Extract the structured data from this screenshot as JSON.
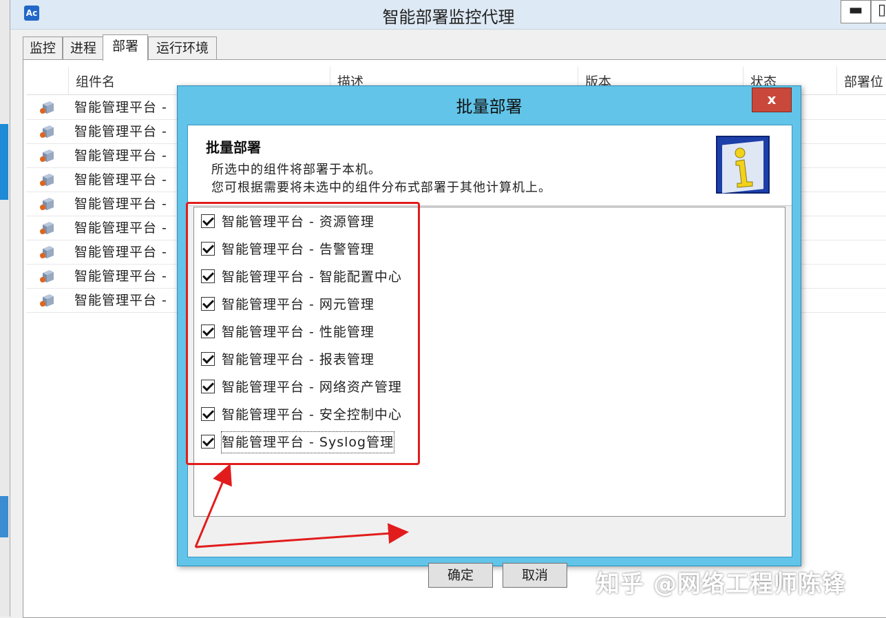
{
  "window": {
    "title": "智能部署监控代理",
    "minimize_label": "▬",
    "maximize_label": "▯"
  },
  "tabs": [
    {
      "label": "监控"
    },
    {
      "label": "进程"
    },
    {
      "label": "部署"
    },
    {
      "label": "运行环境"
    }
  ],
  "active_tab": "部署",
  "list": {
    "columns": [
      "组件名",
      "描述",
      "版本",
      "状态",
      "部署位"
    ],
    "rows": [
      "智能管理平台 -",
      "智能管理平台 -",
      "智能管理平台 -",
      "智能管理平台 -",
      "智能管理平台 -",
      "智能管理平台 -",
      "智能管理平台 -",
      "智能管理平台 -",
      "智能管理平台 -"
    ]
  },
  "dialog": {
    "title": "批量部署",
    "close_label": "x",
    "heading": "批量部署",
    "desc_line1": "所选中的组件将部署于本机。",
    "desc_line2": "您可根据需要将未选中的组件分布式部署于其他计算机上。",
    "items": [
      {
        "label": "智能管理平台 - 资源管理",
        "checked": true
      },
      {
        "label": "智能管理平台 - 告警管理",
        "checked": true
      },
      {
        "label": "智能管理平台 - 智能配置中心",
        "checked": true
      },
      {
        "label": "智能管理平台 - 网元管理",
        "checked": true
      },
      {
        "label": "智能管理平台 - 性能管理",
        "checked": true
      },
      {
        "label": "智能管理平台 - 报表管理",
        "checked": true
      },
      {
        "label": "智能管理平台 - 网络资产管理",
        "checked": true
      },
      {
        "label": "智能管理平台 - 安全控制中心",
        "checked": true
      },
      {
        "label": "智能管理平台 - Syslog管理",
        "checked": true
      }
    ],
    "ok_label": "确定",
    "cancel_label": "取消"
  },
  "watermark": "知乎 @网络工程师陈锋",
  "colors": {
    "dialog_frame": "#61c4e8",
    "close_button": "#c9483b",
    "annotation": "#e21c1c"
  },
  "icons": {
    "app": "app-icon",
    "component": "component-box-icon",
    "info": "info-icon",
    "checkbox": "checkbox-checked-icon"
  }
}
